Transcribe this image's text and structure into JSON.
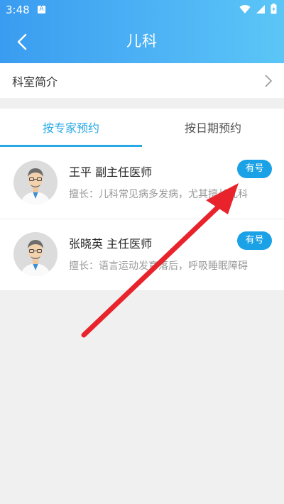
{
  "status_bar": {
    "time": "3:48",
    "notification_glyph": "A",
    "icons": [
      "wifi-icon",
      "signal-icon",
      "battery-icon"
    ]
  },
  "nav": {
    "title": "儿科",
    "back_icon": "back-icon"
  },
  "department_intro": {
    "label": "科室简介"
  },
  "tabs": [
    {
      "label": "按专家预约",
      "active": true
    },
    {
      "label": "按日期预约",
      "active": false
    }
  ],
  "doctors": [
    {
      "name": "王平  副主任医师",
      "specialty": "擅长：儿科常见病多发病，尤其擅长儿科",
      "badge": "有号"
    },
    {
      "name": "张晓英  主任医师",
      "specialty": "擅长：语言运动发育落后，呼吸睡眠障碍",
      "badge": "有号"
    }
  ],
  "colors": {
    "header_gradient_start": "#3a9cf0",
    "header_gradient_end": "#5bc6f6",
    "accent": "#28a9e6",
    "badge": "#1aa1e6",
    "annotation_arrow": "#e8232b"
  }
}
